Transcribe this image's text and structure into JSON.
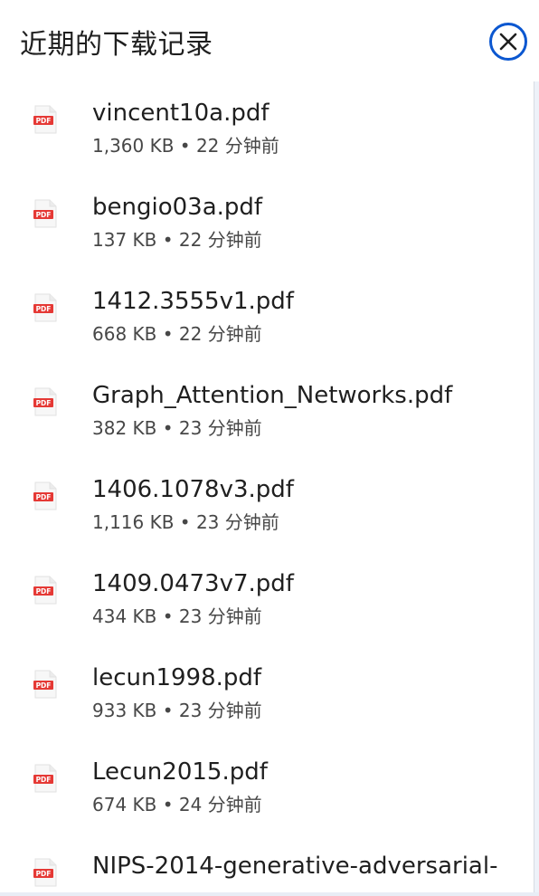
{
  "panel": {
    "title": "近期的下载记录",
    "close_icon": "close-circle-icon",
    "accent_color": "#0b57d0"
  },
  "downloads": [
    {
      "name": "vincent10a.pdf",
      "meta": "1,360 KB • 22 分钟前",
      "icon": "pdf-file-icon"
    },
    {
      "name": "bengio03a.pdf",
      "meta": "137 KB • 22 分钟前",
      "icon": "pdf-file-icon"
    },
    {
      "name": "1412.3555v1.pdf",
      "meta": "668 KB • 22 分钟前",
      "icon": "pdf-file-icon"
    },
    {
      "name": "Graph_Attention_Networks.pdf",
      "meta": "382 KB • 23 分钟前",
      "icon": "pdf-file-icon"
    },
    {
      "name": "1406.1078v3.pdf",
      "meta": "1,116 KB • 23 分钟前",
      "icon": "pdf-file-icon"
    },
    {
      "name": "1409.0473v7.pdf",
      "meta": "434 KB • 23 分钟前",
      "icon": "pdf-file-icon"
    },
    {
      "name": "lecun1998.pdf",
      "meta": "933 KB • 23 分钟前",
      "icon": "pdf-file-icon"
    },
    {
      "name": "Lecun2015.pdf",
      "meta": "674 KB • 24 分钟前",
      "icon": "pdf-file-icon"
    },
    {
      "name": "NIPS-2014-generative-adversarial-",
      "meta": "",
      "icon": "pdf-file-icon"
    }
  ],
  "pdf_badge_text": "PDF",
  "pdf_badge_color": "#e53935"
}
